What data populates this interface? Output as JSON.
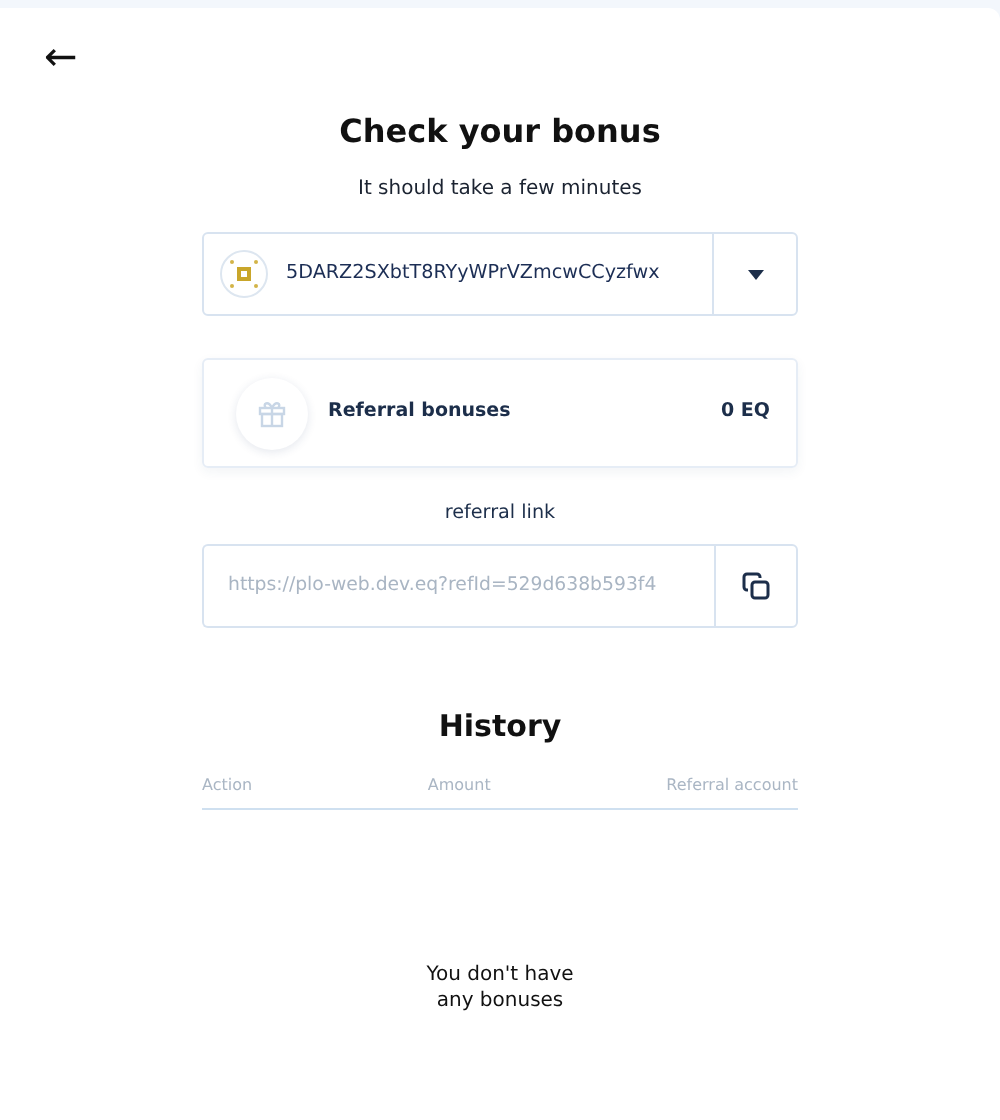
{
  "back": {
    "icon": "←"
  },
  "title": "Check your bonus",
  "subtitle": "It should take a few minutes",
  "account": {
    "address": "5DARZ2SXbtT8RYyWPrVZmcwCCyzfwx"
  },
  "bonus": {
    "label": "Referral bonuses",
    "amount": "0 EQ"
  },
  "referral": {
    "label": "referral link",
    "value": "https://plo-web.dev.eq?refId=529d638b593f4"
  },
  "history": {
    "title": "History",
    "columns": [
      "Action",
      "Amount",
      "Referral account"
    ],
    "empty_message": "You don't have any bonuses"
  }
}
